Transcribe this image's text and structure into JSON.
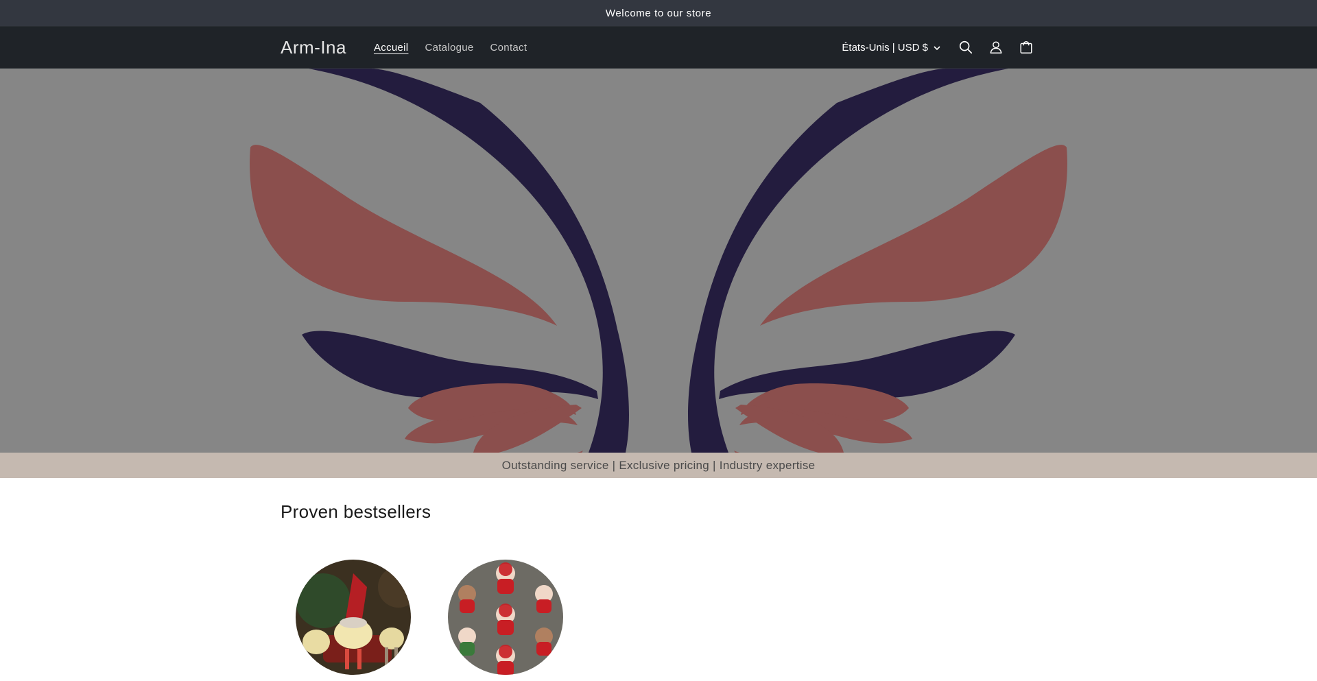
{
  "announcement": {
    "text": "Welcome to our store"
  },
  "header": {
    "logo": "Arm-Ina",
    "nav": [
      {
        "label": "Accueil",
        "active": true
      },
      {
        "label": "Catalogue",
        "active": false
      },
      {
        "label": "Contact",
        "active": false
      }
    ],
    "locale": "États-Unis | USD $",
    "icons": [
      "search-icon",
      "account-icon",
      "cart-icon"
    ]
  },
  "hero": {
    "background": "#868686",
    "petal_dark": "#231c3e",
    "petal_red": "#8b4f4d"
  },
  "value_bar": {
    "text": "Outstanding service | Exclusive pricing | Industry expertise"
  },
  "bestsellers": {
    "title": "Proven bestsellers",
    "products": [
      {
        "name": "gnome-lamp-product-image"
      },
      {
        "name": "santa-plush-product-image"
      }
    ]
  },
  "colors": {
    "announcement_bg": "#333740",
    "header_bg": "#1f2328",
    "value_bar_bg": "#c5b9b0"
  }
}
